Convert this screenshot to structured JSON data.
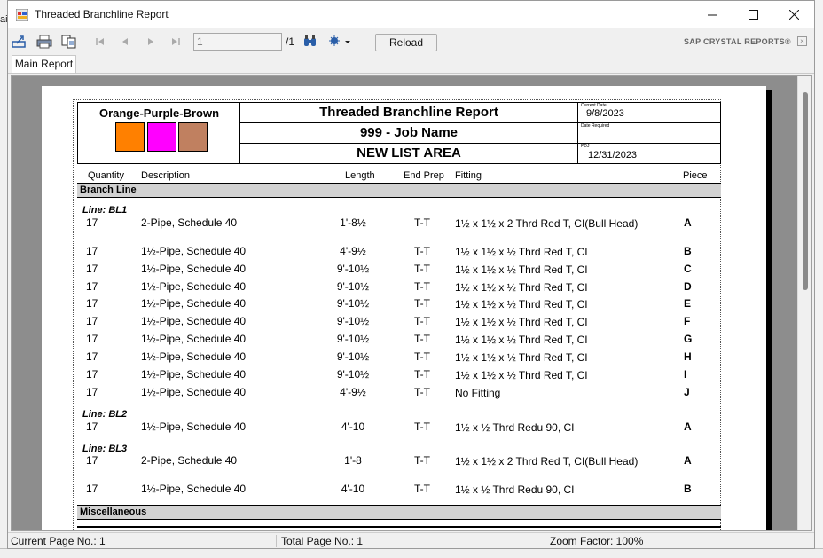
{
  "window": {
    "title": "Threaded Branchline Report",
    "minimize_glyph": "—",
    "maximize_glyph": "☐",
    "close_glyph": "✕"
  },
  "toolbar": {
    "page_input_value": "1",
    "page_total": "/1",
    "reload_label": "Reload",
    "brand": "SAP CRYSTAL REPORTS®",
    "icons": [
      "export-icon",
      "print-icon",
      "copy-icon",
      "first-page-icon",
      "prev-page-icon",
      "next-page-icon",
      "last-page-icon",
      "find-icon",
      "zoom-icon"
    ]
  },
  "tabs": [
    {
      "label": "Main Report"
    }
  ],
  "report": {
    "colors_title": "Orange-Purple-Brown",
    "swatches": [
      {
        "name": "Orange",
        "color": "#ff8000"
      },
      {
        "name": "Purple",
        "color": "#ff00ff"
      },
      {
        "name": "Brown",
        "color": "#c08060"
      }
    ],
    "title": "Threaded Branchline Report",
    "job": "999 - Job Name",
    "list_area": "NEW LIST AREA",
    "current_date_label": "Current Date",
    "current_date": "9/8/2023",
    "date_required_label": "Date Required",
    "date_required": "",
    "pdj_label": "PDJ",
    "pdj": "12/31/2023",
    "columns": {
      "quantity": "Quantity",
      "description": "Description",
      "length": "Length",
      "end_prep": "End Prep",
      "fitting": "Fitting",
      "piece": "Piece"
    },
    "section_branch": "Branch Line",
    "section_misc": "Miscellaneous",
    "lines": [
      {
        "label": "Line:  BL1",
        "rows": [
          {
            "qty": "17",
            "desc": "2-Pipe, Schedule 40",
            "len": "1'-8½",
            "prep": "T-T",
            "fit": "1½ x 1½ x 2 Thrd Red T, CI(Bull Head)",
            "piece": "A"
          },
          {
            "qty": "17",
            "desc": "1½-Pipe, Schedule 40",
            "len": "4'-9½",
            "prep": "T-T",
            "fit": "1½ x 1½ x ½ Thrd Red T, CI",
            "piece": "B"
          },
          {
            "qty": "17",
            "desc": "1½-Pipe, Schedule 40",
            "len": "9'-10½",
            "prep": "T-T",
            "fit": "1½ x 1½ x ½ Thrd Red T, CI",
            "piece": "C"
          },
          {
            "qty": "17",
            "desc": "1½-Pipe, Schedule 40",
            "len": "9'-10½",
            "prep": "T-T",
            "fit": "1½ x 1½ x ½ Thrd Red T, CI",
            "piece": "D"
          },
          {
            "qty": "17",
            "desc": "1½-Pipe, Schedule 40",
            "len": "9'-10½",
            "prep": "T-T",
            "fit": "1½ x 1½ x ½ Thrd Red T, CI",
            "piece": "E"
          },
          {
            "qty": "17",
            "desc": "1½-Pipe, Schedule 40",
            "len": "9'-10½",
            "prep": "T-T",
            "fit": "1½ x 1½ x ½ Thrd Red T, CI",
            "piece": "F"
          },
          {
            "qty": "17",
            "desc": "1½-Pipe, Schedule 40",
            "len": "9'-10½",
            "prep": "T-T",
            "fit": "1½ x 1½ x ½ Thrd Red T, CI",
            "piece": "G"
          },
          {
            "qty": "17",
            "desc": "1½-Pipe, Schedule 40",
            "len": "9'-10½",
            "prep": "T-T",
            "fit": "1½ x 1½ x ½ Thrd Red T, CI",
            "piece": "H"
          },
          {
            "qty": "17",
            "desc": "1½-Pipe, Schedule 40",
            "len": "9'-10½",
            "prep": "T-T",
            "fit": "1½ x 1½ x ½ Thrd Red T, CI",
            "piece": "I"
          },
          {
            "qty": "17",
            "desc": "1½-Pipe, Schedule 40",
            "len": "4'-9½",
            "prep": "T-T",
            "fit": "No Fitting",
            "piece": "J"
          }
        ]
      },
      {
        "label": "Line:  BL2",
        "rows": [
          {
            "qty": "17",
            "desc": "1½-Pipe, Schedule 40",
            "len": "4'-10",
            "prep": "T-T",
            "fit": "1½ x ½ Thrd Redu 90, CI",
            "piece": "A"
          }
        ]
      },
      {
        "label": "Line:  BL3",
        "rows": [
          {
            "qty": "17",
            "desc": "2-Pipe, Schedule 40",
            "len": "1'-8",
            "prep": "T-T",
            "fit": "1½ x 1½ x 2 Thrd Red T, CI(Bull Head)",
            "piece": "A"
          },
          {
            "qty": "17",
            "desc": "1½-Pipe, Schedule 40",
            "len": "4'-10",
            "prep": "T-T",
            "fit": "1½ x ½ Thrd Redu 90, CI",
            "piece": "B"
          }
        ]
      }
    ]
  },
  "status": {
    "current_page": "Current Page No.: 1",
    "total_page": "Total Page No.: 1",
    "zoom": "Zoom Factor: 100%"
  }
}
